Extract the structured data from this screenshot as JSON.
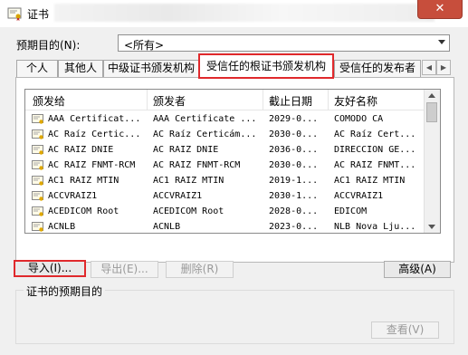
{
  "window": {
    "title": "证书",
    "close_label": "✕"
  },
  "purpose": {
    "label": "预期目的(N):",
    "selected": "<所有>"
  },
  "tabs": [
    {
      "label": "个人"
    },
    {
      "label": "其他人"
    },
    {
      "label": "中级证书颁发机构"
    },
    {
      "label": "受信任的根证书颁发机构"
    },
    {
      "label": "受信任的发布者"
    }
  ],
  "tab_scroll": {
    "left": "◀",
    "right": "▶"
  },
  "list": {
    "columns": [
      "颁发给",
      "颁发者",
      "截止日期",
      "友好名称"
    ],
    "rows": [
      [
        "AAA Certificat...",
        "AAA Certificate ...",
        "2029-0...",
        "COMODO CA"
      ],
      [
        "AC Raíz Certic...",
        "AC Raíz Certicám...",
        "2030-0...",
        "AC Raíz Cert..."
      ],
      [
        "AC RAIZ DNIE",
        "AC RAIZ DNIE",
        "2036-0...",
        "DIRECCION GE..."
      ],
      [
        "AC RAIZ FNMT-RCM",
        "AC RAIZ FNMT-RCM",
        "2030-0...",
        "AC RAIZ FNMT..."
      ],
      [
        "AC1 RAIZ MTIN",
        "AC1 RAIZ MTIN",
        "2019-1...",
        "AC1 RAIZ MTIN"
      ],
      [
        "ACCVRAIZ1",
        "ACCVRAIZ1",
        "2030-1...",
        "ACCVRAIZ1"
      ],
      [
        "ACEDICOM Root",
        "ACEDICOM Root",
        "2028-0...",
        "EDICOM"
      ],
      [
        "ACNLB",
        "ACNLB",
        "2023-0...",
        "NLB Nova Lju..."
      ]
    ]
  },
  "buttons": {
    "import": "导入(I)...",
    "export": "导出(E)...",
    "remove": "删除(R)",
    "advanced": "高级(A)",
    "view": "查看(V)"
  },
  "purposes_group": {
    "label": "证书的预期目的"
  },
  "colors": {
    "highlight": "#e0292c",
    "close": "#c74e3c"
  }
}
